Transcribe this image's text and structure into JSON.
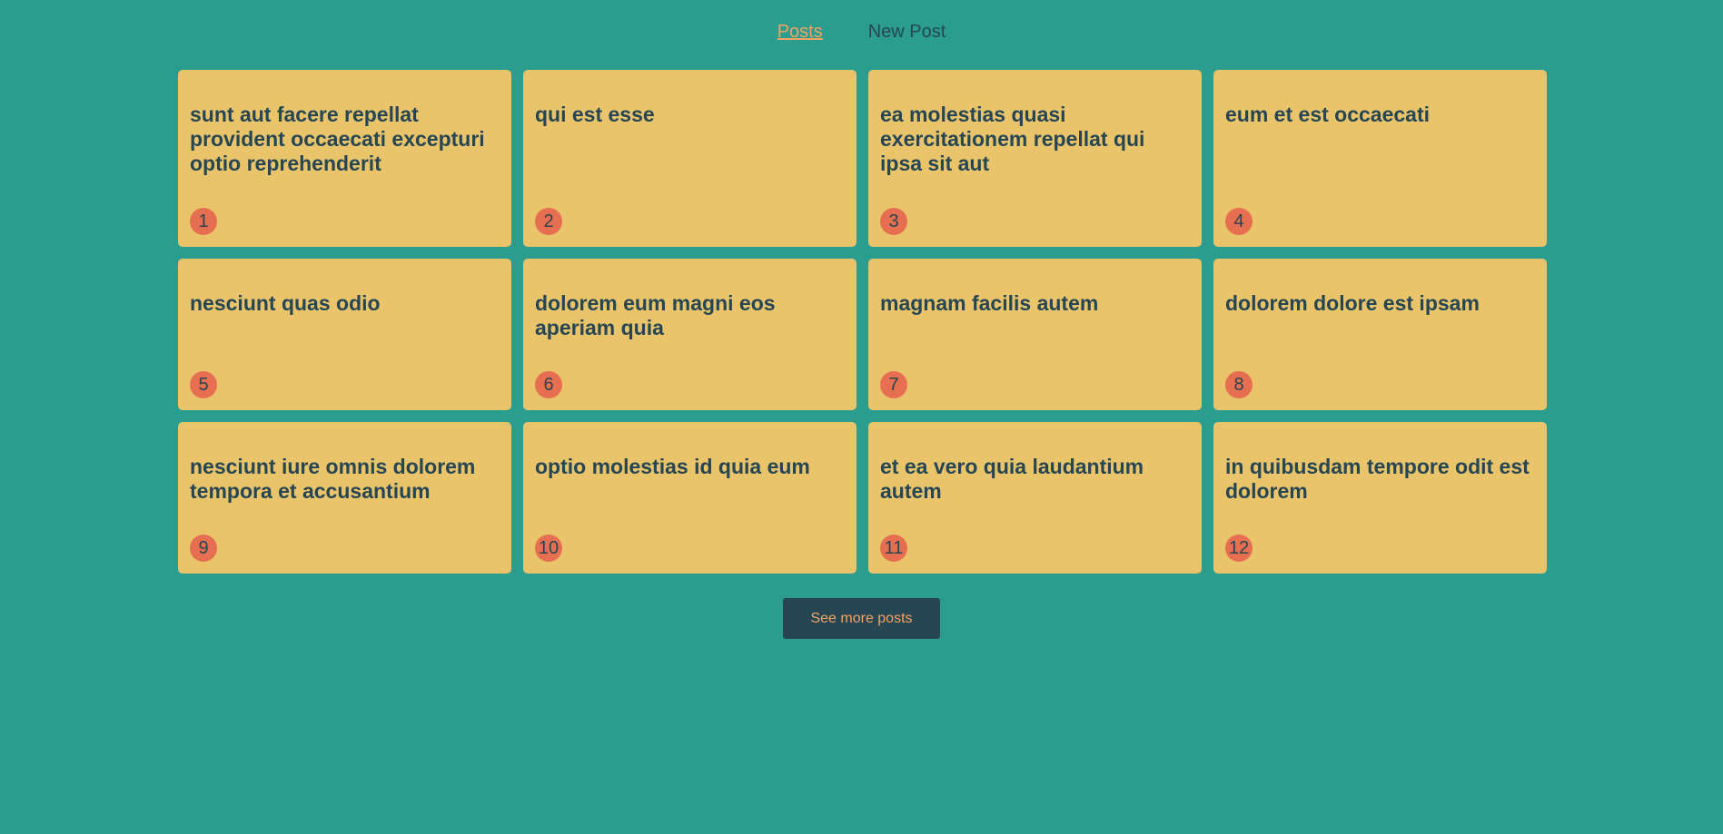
{
  "nav": {
    "posts_label": "Posts",
    "new_post_label": "New Post"
  },
  "posts": [
    {
      "title": "sunt aut facere repellat provident occaecati excepturi optio reprehenderit",
      "id": "1"
    },
    {
      "title": "qui est esse",
      "id": "2"
    },
    {
      "title": "ea molestias quasi exercitationem repellat qui ipsa sit aut",
      "id": "3"
    },
    {
      "title": "eum et est occaecati",
      "id": "4"
    },
    {
      "title": "nesciunt quas odio",
      "id": "5"
    },
    {
      "title": "dolorem eum magni eos aperiam quia",
      "id": "6"
    },
    {
      "title": "magnam facilis autem",
      "id": "7"
    },
    {
      "title": "dolorem dolore est ipsam",
      "id": "8"
    },
    {
      "title": "nesciunt iure omnis dolorem tempora et accusantium",
      "id": "9"
    },
    {
      "title": "optio molestias id quia eum",
      "id": "10"
    },
    {
      "title": "et ea vero quia laudantium autem",
      "id": "11"
    },
    {
      "title": "in quibusdam tempore odit est dolorem",
      "id": "12"
    }
  ],
  "more_button_label": "See more posts",
  "colors": {
    "background": "#2a9d8f",
    "card": "#e9c46a",
    "badge": "#e76f51",
    "text": "#264653",
    "accent": "#f4a261"
  }
}
